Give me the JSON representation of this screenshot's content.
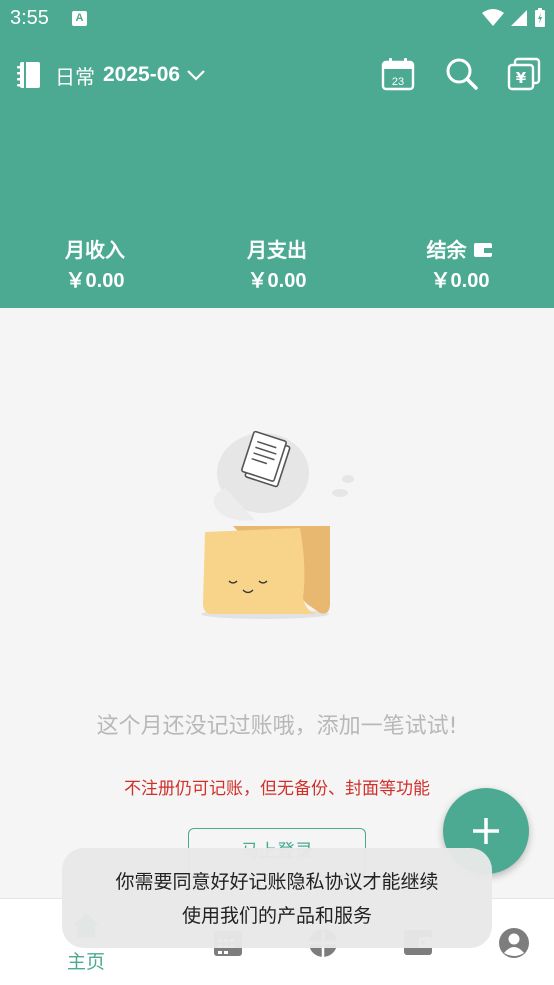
{
  "status_bar": {
    "time": "3:55",
    "notification_icon": "A"
  },
  "header": {
    "book_name": "日常",
    "month": "2025-06",
    "icons": [
      "notebook-icon",
      "calendar-icon",
      "search-icon",
      "currency-icon"
    ],
    "calendar_day": "23"
  },
  "summary": {
    "income_label": "月收入",
    "income_value": "￥0.00",
    "expense_label": "月支出",
    "expense_value": "￥0.00",
    "balance_label": "结余",
    "balance_value": "￥0.00"
  },
  "empty": {
    "message": "这个月还没记过账哦，添加一笔试试!",
    "warning": "不注册仍可记账，但无备份、封面等功能",
    "login_label": "马上登录"
  },
  "toast": {
    "line1": "你需要同意好好记账隐私协议才能继续",
    "line2": "使用我们的产品和服务"
  },
  "tabs": [
    {
      "label": "主页",
      "icon": "home-icon",
      "active": true
    },
    {
      "label": "",
      "icon": "calendar-grid-icon",
      "active": false
    },
    {
      "label": "",
      "icon": "pie-chart-icon",
      "active": false
    },
    {
      "label": "",
      "icon": "wallet-icon",
      "active": false
    },
    {
      "label": "",
      "icon": "profile-icon",
      "active": false
    }
  ],
  "colors": {
    "accent": "#4caa92",
    "warning": "#d0302a",
    "inactive_icon": "#7d7d7d"
  }
}
